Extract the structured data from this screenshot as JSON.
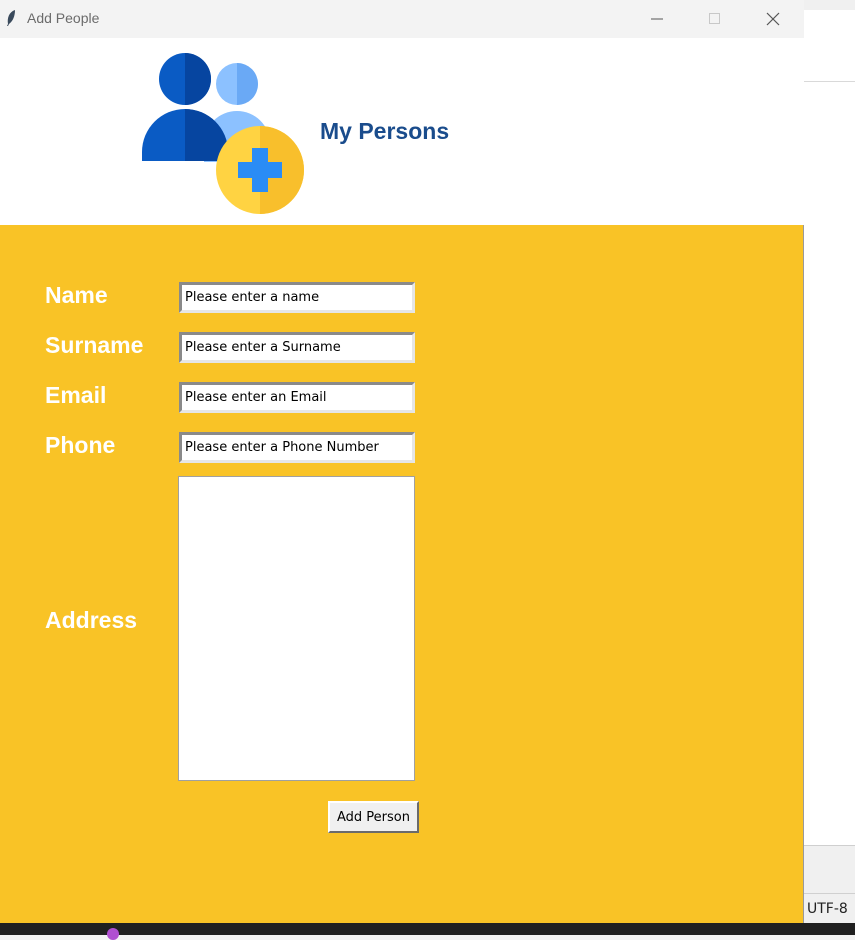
{
  "window": {
    "title": "Add People"
  },
  "header": {
    "heading": "My Persons",
    "logo_icon": "add-people-icon"
  },
  "form": {
    "name": {
      "label": "Name",
      "placeholder": "Please enter a name"
    },
    "surname": {
      "label": "Surname",
      "placeholder": "Please enter a Surname"
    },
    "email": {
      "label": "Email",
      "placeholder": "Please enter an Email"
    },
    "phone": {
      "label": "Phone",
      "placeholder": "Please enter a Phone Number"
    },
    "address": {
      "label": "Address",
      "value": ""
    },
    "submit_label": "Add Person"
  },
  "background": {
    "encoding": "UTF-8"
  },
  "colors": {
    "form_bg": "#f9c326",
    "heading": "#1a4c8c",
    "header_bg": "#ffffff"
  }
}
